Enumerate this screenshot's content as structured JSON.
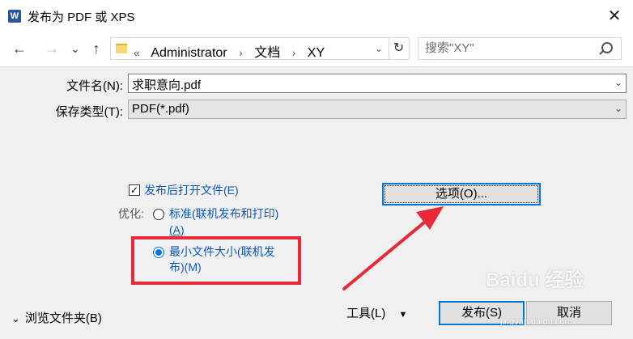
{
  "window": {
    "title": "发布为 PDF 或 XPS",
    "app_icon": "W",
    "close": "✕"
  },
  "nav": {
    "back": "←",
    "forward": "→",
    "recent": "⌄",
    "up": "↑",
    "breadcrumb_prefix": "«",
    "breadcrumbs": [
      "Administrator",
      "文档",
      "XY"
    ],
    "separator": "›",
    "dropdown": "⌄",
    "refresh": "↻",
    "search_placeholder": "搜索\"XY\""
  },
  "fields": {
    "filename_label": "文件名(N):",
    "filename_value": "求职意向.pdf",
    "type_label": "保存类型(T):",
    "type_value": "PDF(*.pdf)",
    "arrow": "⌄"
  },
  "options": {
    "open_after_publish": {
      "label": "发布后打开文件(E)",
      "checked": true,
      "mark": "✓"
    },
    "optimize_label": "优化:",
    "standard_line1": "标准(联机发布和打印)",
    "standard_line2": "(A)",
    "minimum_line1": "最小文件大小(联机发",
    "minimum_line2": "布)(M)",
    "selected": "minimum",
    "options_button": "选项(O)..."
  },
  "footer": {
    "browse_folders": "浏览文件夹(B)",
    "browse_chevron": "⌄",
    "tools": "工具(L)",
    "tools_arrow": "▼",
    "publish": "发布(S)",
    "cancel": "取消"
  },
  "watermark": {
    "text": "Baidu 经验",
    "sub": "jingyan.baidu.com"
  },
  "colors": {
    "accent": "#0078d7",
    "annotation_red": "#e8293a",
    "link_blue": "#0b59b5"
  }
}
